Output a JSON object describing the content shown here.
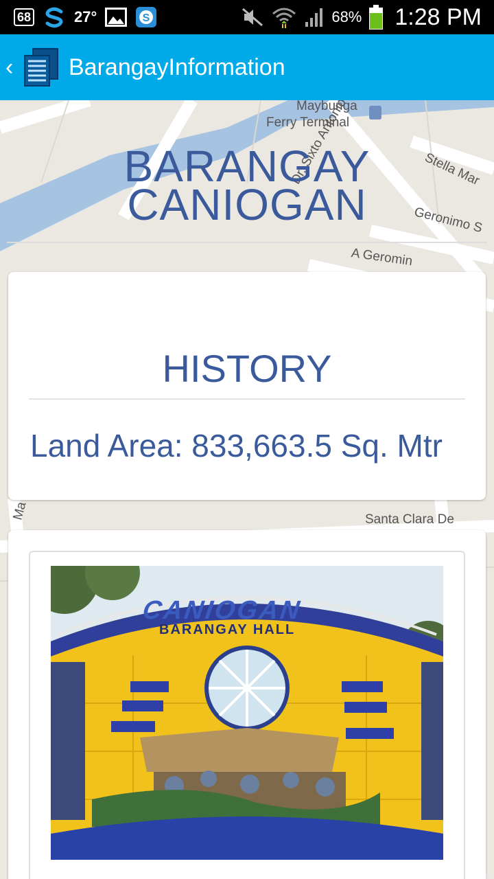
{
  "status_bar": {
    "notification_count": "68",
    "temperature": "27°",
    "battery_percent": "68%",
    "time": "1:28 PM"
  },
  "action_bar": {
    "title": "BarangayInformation"
  },
  "map_labels": {
    "ferry_name": "Maybunga",
    "ferry_terminal": "Ferry Terminal",
    "street_antonio": "Dr. Sixto Antonio Ave",
    "street_stella": "Stella Mar",
    "street_geronimo": "Geronimo S",
    "street_a_geronimo": "A Geromin",
    "street_ma": "Ma",
    "street_santa_clara": "Santa Clara De"
  },
  "header": {
    "title_line1": "BARANGAY",
    "title_line2": "CANIOGAN"
  },
  "history_card": {
    "title": "HISTORY",
    "land_area": "Land Area: 833,663.5 Sq. Mtr"
  },
  "photo_card": {
    "sign_text": "CANIOGAN",
    "sign_subtext": "BARANGAY HALL"
  }
}
